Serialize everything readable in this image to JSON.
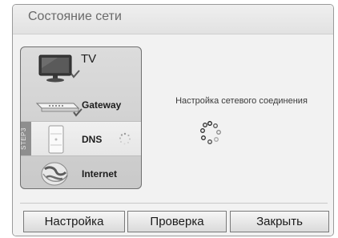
{
  "window": {
    "title": "Состояние сети"
  },
  "steps": {
    "items": [
      {
        "label": "TV"
      },
      {
        "label": "Gateway"
      },
      {
        "label": "DNS",
        "step_tag": "STEP3"
      },
      {
        "label": "Internet"
      }
    ]
  },
  "status": {
    "message": "Настройка сетевого соединения"
  },
  "buttons": {
    "setup": "Настройка",
    "check": "Проверка",
    "close": "Закрыть"
  },
  "icons": {
    "tv": "tv-icon",
    "gateway": "router-icon",
    "dns": "server-icon",
    "internet": "globe-icon",
    "check": "checkmark-icon",
    "loading": "loading-spinner-icon"
  },
  "colors": {
    "background": "#f2f2f2",
    "title_text": "#6a6a6a",
    "panel": "#d4d4d4",
    "active_step": "#ececec"
  }
}
